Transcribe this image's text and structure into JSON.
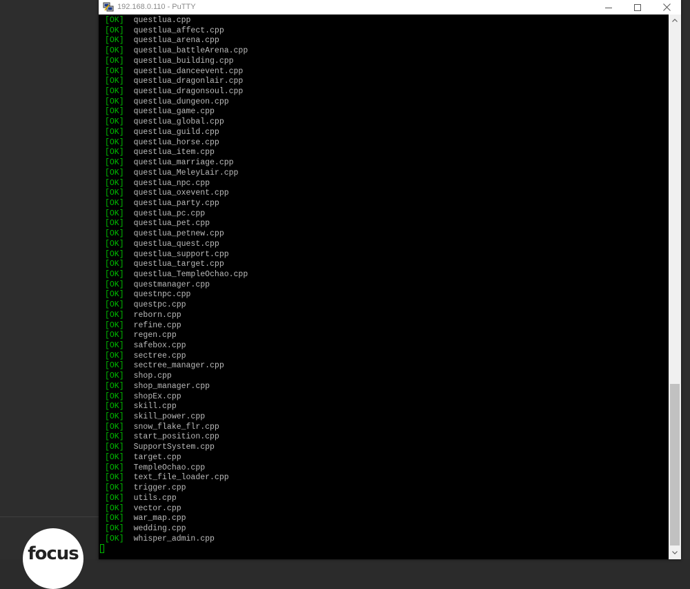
{
  "window": {
    "title": "192.168.0.110 - PuTTY",
    "icon": "putty-icon"
  },
  "window_controls": {
    "minimize_icon": "minimize-icon",
    "maximize_icon": "maximize-icon",
    "close_icon": "close-icon"
  },
  "desktop": {
    "logo_text": "focus"
  },
  "terminal": {
    "status_tag": "[OK]",
    "colors": {
      "background": "#000000",
      "ok_tag": "#00bb00",
      "text": "#bbbbbb",
      "cursor": "#00bb00"
    },
    "files": [
      "questlua.cpp",
      "questlua_affect.cpp",
      "questlua_arena.cpp",
      "questlua_battleArena.cpp",
      "questlua_building.cpp",
      "questlua_danceevent.cpp",
      "questlua_dragonlair.cpp",
      "questlua_dragonsoul.cpp",
      "questlua_dungeon.cpp",
      "questlua_game.cpp",
      "questlua_global.cpp",
      "questlua_guild.cpp",
      "questlua_horse.cpp",
      "questlua_item.cpp",
      "questlua_marriage.cpp",
      "questlua_MeleyLair.cpp",
      "questlua_npc.cpp",
      "questlua_oxevent.cpp",
      "questlua_party.cpp",
      "questlua_pc.cpp",
      "questlua_pet.cpp",
      "questlua_petnew.cpp",
      "questlua_quest.cpp",
      "questlua_support.cpp",
      "questlua_target.cpp",
      "questlua_TempleOchao.cpp",
      "questmanager.cpp",
      "questnpc.cpp",
      "questpc.cpp",
      "reborn.cpp",
      "refine.cpp",
      "regen.cpp",
      "safebox.cpp",
      "sectree.cpp",
      "sectree_manager.cpp",
      "shop.cpp",
      "shop_manager.cpp",
      "shopEx.cpp",
      "skill.cpp",
      "skill_power.cpp",
      "snow_flake_flr.cpp",
      "start_position.cpp",
      "SupportSystem.cpp",
      "target.cpp",
      "TempleOchao.cpp",
      "text_file_loader.cpp",
      "trigger.cpp",
      "utils.cpp",
      "vector.cpp",
      "war_map.cpp",
      "wedding.cpp",
      "whisper_admin.cpp"
    ]
  },
  "scrollbar": {
    "up_icon": "scroll-up-arrow-icon",
    "down_icon": "scroll-down-arrow-icon",
    "position_fraction": 0.96
  }
}
